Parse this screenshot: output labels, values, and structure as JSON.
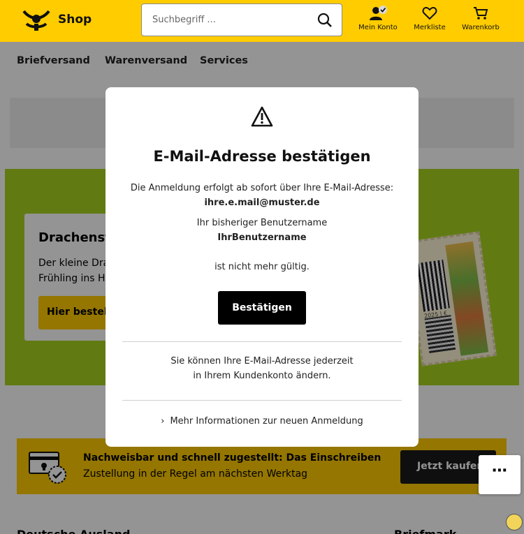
{
  "header": {
    "shop_label": "Shop",
    "search_placeholder": "Suchbegriff ...",
    "account_label": "Mein Konto",
    "wishlist_label": "Merkliste",
    "cart_label": "Warenkorb"
  },
  "nav": {
    "items": [
      {
        "label": "Briefversand"
      },
      {
        "label": "Warenversand"
      },
      {
        "label": "Services"
      }
    ]
  },
  "hero": {
    "title": "Drachensta",
    "text_line1": "Der kleine Dra",
    "text_line2": "Frühling ins H",
    "button_label": "Hier bestell",
    "stamp_year": "2025 | €"
  },
  "promo": {
    "title": "Nachweisbar und schnell zugestellt: Das Einschreiben",
    "subtitle": "Zustellung in der Regel am nächsten Werktag",
    "button_label": "Jetzt kaufen"
  },
  "bottom": {
    "heading_left": "Deutsche Ausland",
    "heading_right": "Briefmark"
  },
  "modal": {
    "title": "E-Mail-Adresse bestätigen",
    "line1": "Die Anmeldung erfolgt ab sofort über Ihre E-Mail-Adresse:",
    "email": "ihre.e.mail@muster.de",
    "line2": "Ihr bisheriger Benutzername",
    "username": "IhrBenutzername",
    "line3": "ist nicht mehr gültig.",
    "confirm_label": "Bestätigen",
    "info_line1": "Sie können Ihre E-Mail-Adresse jederzeit",
    "info_line2": "in Ihrem Kundenkonto ändern.",
    "more_link": "Mehr Informationen zur neuen Anmeldung"
  },
  "fab_label": "⋯",
  "colors": {
    "brand_yellow": "#ffcc00",
    "hero_green": "#a8d51f",
    "button_dark": "#000000"
  }
}
